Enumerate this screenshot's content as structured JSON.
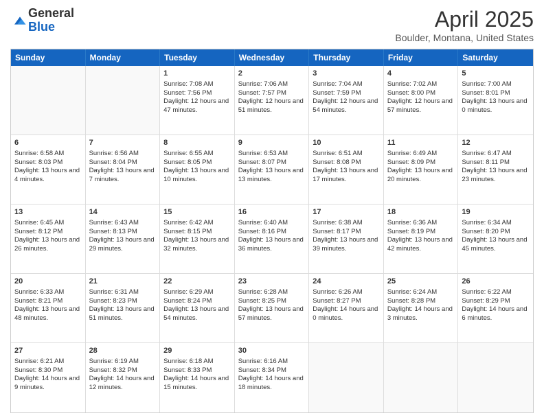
{
  "logo": {
    "general": "General",
    "blue": "Blue"
  },
  "title": "April 2025",
  "subtitle": "Boulder, Montana, United States",
  "days": [
    "Sunday",
    "Monday",
    "Tuesday",
    "Wednesday",
    "Thursday",
    "Friday",
    "Saturday"
  ],
  "weeks": [
    [
      {
        "day": "",
        "info": ""
      },
      {
        "day": "",
        "info": ""
      },
      {
        "day": "1",
        "info": "Sunrise: 7:08 AM\nSunset: 7:56 PM\nDaylight: 12 hours and 47 minutes."
      },
      {
        "day": "2",
        "info": "Sunrise: 7:06 AM\nSunset: 7:57 PM\nDaylight: 12 hours and 51 minutes."
      },
      {
        "day": "3",
        "info": "Sunrise: 7:04 AM\nSunset: 7:59 PM\nDaylight: 12 hours and 54 minutes."
      },
      {
        "day": "4",
        "info": "Sunrise: 7:02 AM\nSunset: 8:00 PM\nDaylight: 12 hours and 57 minutes."
      },
      {
        "day": "5",
        "info": "Sunrise: 7:00 AM\nSunset: 8:01 PM\nDaylight: 13 hours and 0 minutes."
      }
    ],
    [
      {
        "day": "6",
        "info": "Sunrise: 6:58 AM\nSunset: 8:03 PM\nDaylight: 13 hours and 4 minutes."
      },
      {
        "day": "7",
        "info": "Sunrise: 6:56 AM\nSunset: 8:04 PM\nDaylight: 13 hours and 7 minutes."
      },
      {
        "day": "8",
        "info": "Sunrise: 6:55 AM\nSunset: 8:05 PM\nDaylight: 13 hours and 10 minutes."
      },
      {
        "day": "9",
        "info": "Sunrise: 6:53 AM\nSunset: 8:07 PM\nDaylight: 13 hours and 13 minutes."
      },
      {
        "day": "10",
        "info": "Sunrise: 6:51 AM\nSunset: 8:08 PM\nDaylight: 13 hours and 17 minutes."
      },
      {
        "day": "11",
        "info": "Sunrise: 6:49 AM\nSunset: 8:09 PM\nDaylight: 13 hours and 20 minutes."
      },
      {
        "day": "12",
        "info": "Sunrise: 6:47 AM\nSunset: 8:11 PM\nDaylight: 13 hours and 23 minutes."
      }
    ],
    [
      {
        "day": "13",
        "info": "Sunrise: 6:45 AM\nSunset: 8:12 PM\nDaylight: 13 hours and 26 minutes."
      },
      {
        "day": "14",
        "info": "Sunrise: 6:43 AM\nSunset: 8:13 PM\nDaylight: 13 hours and 29 minutes."
      },
      {
        "day": "15",
        "info": "Sunrise: 6:42 AM\nSunset: 8:15 PM\nDaylight: 13 hours and 32 minutes."
      },
      {
        "day": "16",
        "info": "Sunrise: 6:40 AM\nSunset: 8:16 PM\nDaylight: 13 hours and 36 minutes."
      },
      {
        "day": "17",
        "info": "Sunrise: 6:38 AM\nSunset: 8:17 PM\nDaylight: 13 hours and 39 minutes."
      },
      {
        "day": "18",
        "info": "Sunrise: 6:36 AM\nSunset: 8:19 PM\nDaylight: 13 hours and 42 minutes."
      },
      {
        "day": "19",
        "info": "Sunrise: 6:34 AM\nSunset: 8:20 PM\nDaylight: 13 hours and 45 minutes."
      }
    ],
    [
      {
        "day": "20",
        "info": "Sunrise: 6:33 AM\nSunset: 8:21 PM\nDaylight: 13 hours and 48 minutes."
      },
      {
        "day": "21",
        "info": "Sunrise: 6:31 AM\nSunset: 8:23 PM\nDaylight: 13 hours and 51 minutes."
      },
      {
        "day": "22",
        "info": "Sunrise: 6:29 AM\nSunset: 8:24 PM\nDaylight: 13 hours and 54 minutes."
      },
      {
        "day": "23",
        "info": "Sunrise: 6:28 AM\nSunset: 8:25 PM\nDaylight: 13 hours and 57 minutes."
      },
      {
        "day": "24",
        "info": "Sunrise: 6:26 AM\nSunset: 8:27 PM\nDaylight: 14 hours and 0 minutes."
      },
      {
        "day": "25",
        "info": "Sunrise: 6:24 AM\nSunset: 8:28 PM\nDaylight: 14 hours and 3 minutes."
      },
      {
        "day": "26",
        "info": "Sunrise: 6:22 AM\nSunset: 8:29 PM\nDaylight: 14 hours and 6 minutes."
      }
    ],
    [
      {
        "day": "27",
        "info": "Sunrise: 6:21 AM\nSunset: 8:30 PM\nDaylight: 14 hours and 9 minutes."
      },
      {
        "day": "28",
        "info": "Sunrise: 6:19 AM\nSunset: 8:32 PM\nDaylight: 14 hours and 12 minutes."
      },
      {
        "day": "29",
        "info": "Sunrise: 6:18 AM\nSunset: 8:33 PM\nDaylight: 14 hours and 15 minutes."
      },
      {
        "day": "30",
        "info": "Sunrise: 6:16 AM\nSunset: 8:34 PM\nDaylight: 14 hours and 18 minutes."
      },
      {
        "day": "",
        "info": ""
      },
      {
        "day": "",
        "info": ""
      },
      {
        "day": "",
        "info": ""
      }
    ]
  ]
}
